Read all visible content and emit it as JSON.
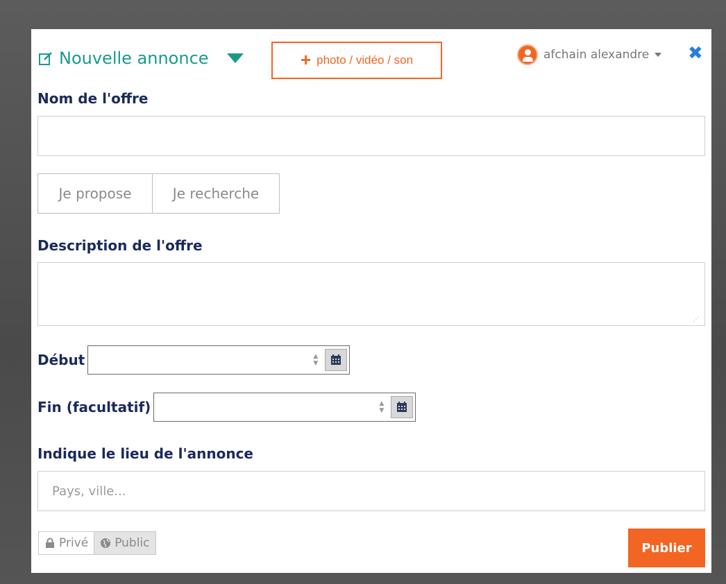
{
  "header": {
    "title": "Nouvelle annonce",
    "media_button": "photo / vidéo / son",
    "user_name": "afchain alexandre",
    "close": "✖"
  },
  "form": {
    "name_label": "Nom de l'offre",
    "name_value": "",
    "type_options": [
      "Je propose",
      "Je recherche"
    ],
    "description_label": "Description de l'offre",
    "description_value": "",
    "start_label": "Début",
    "start_value": "",
    "end_label": "Fin (facultatif)",
    "end_value": "",
    "location_label": "Indique le lieu de l'annonce",
    "location_placeholder": "Pays, ville..."
  },
  "footer": {
    "private_label": "Privé",
    "public_label": "Public",
    "selected_visibility": "Public",
    "publish_label": "Publier"
  },
  "colors": {
    "accent": "#f26522",
    "teal": "#1a9a8c",
    "label": "#1b2a5a",
    "close": "#2a7fd4"
  }
}
